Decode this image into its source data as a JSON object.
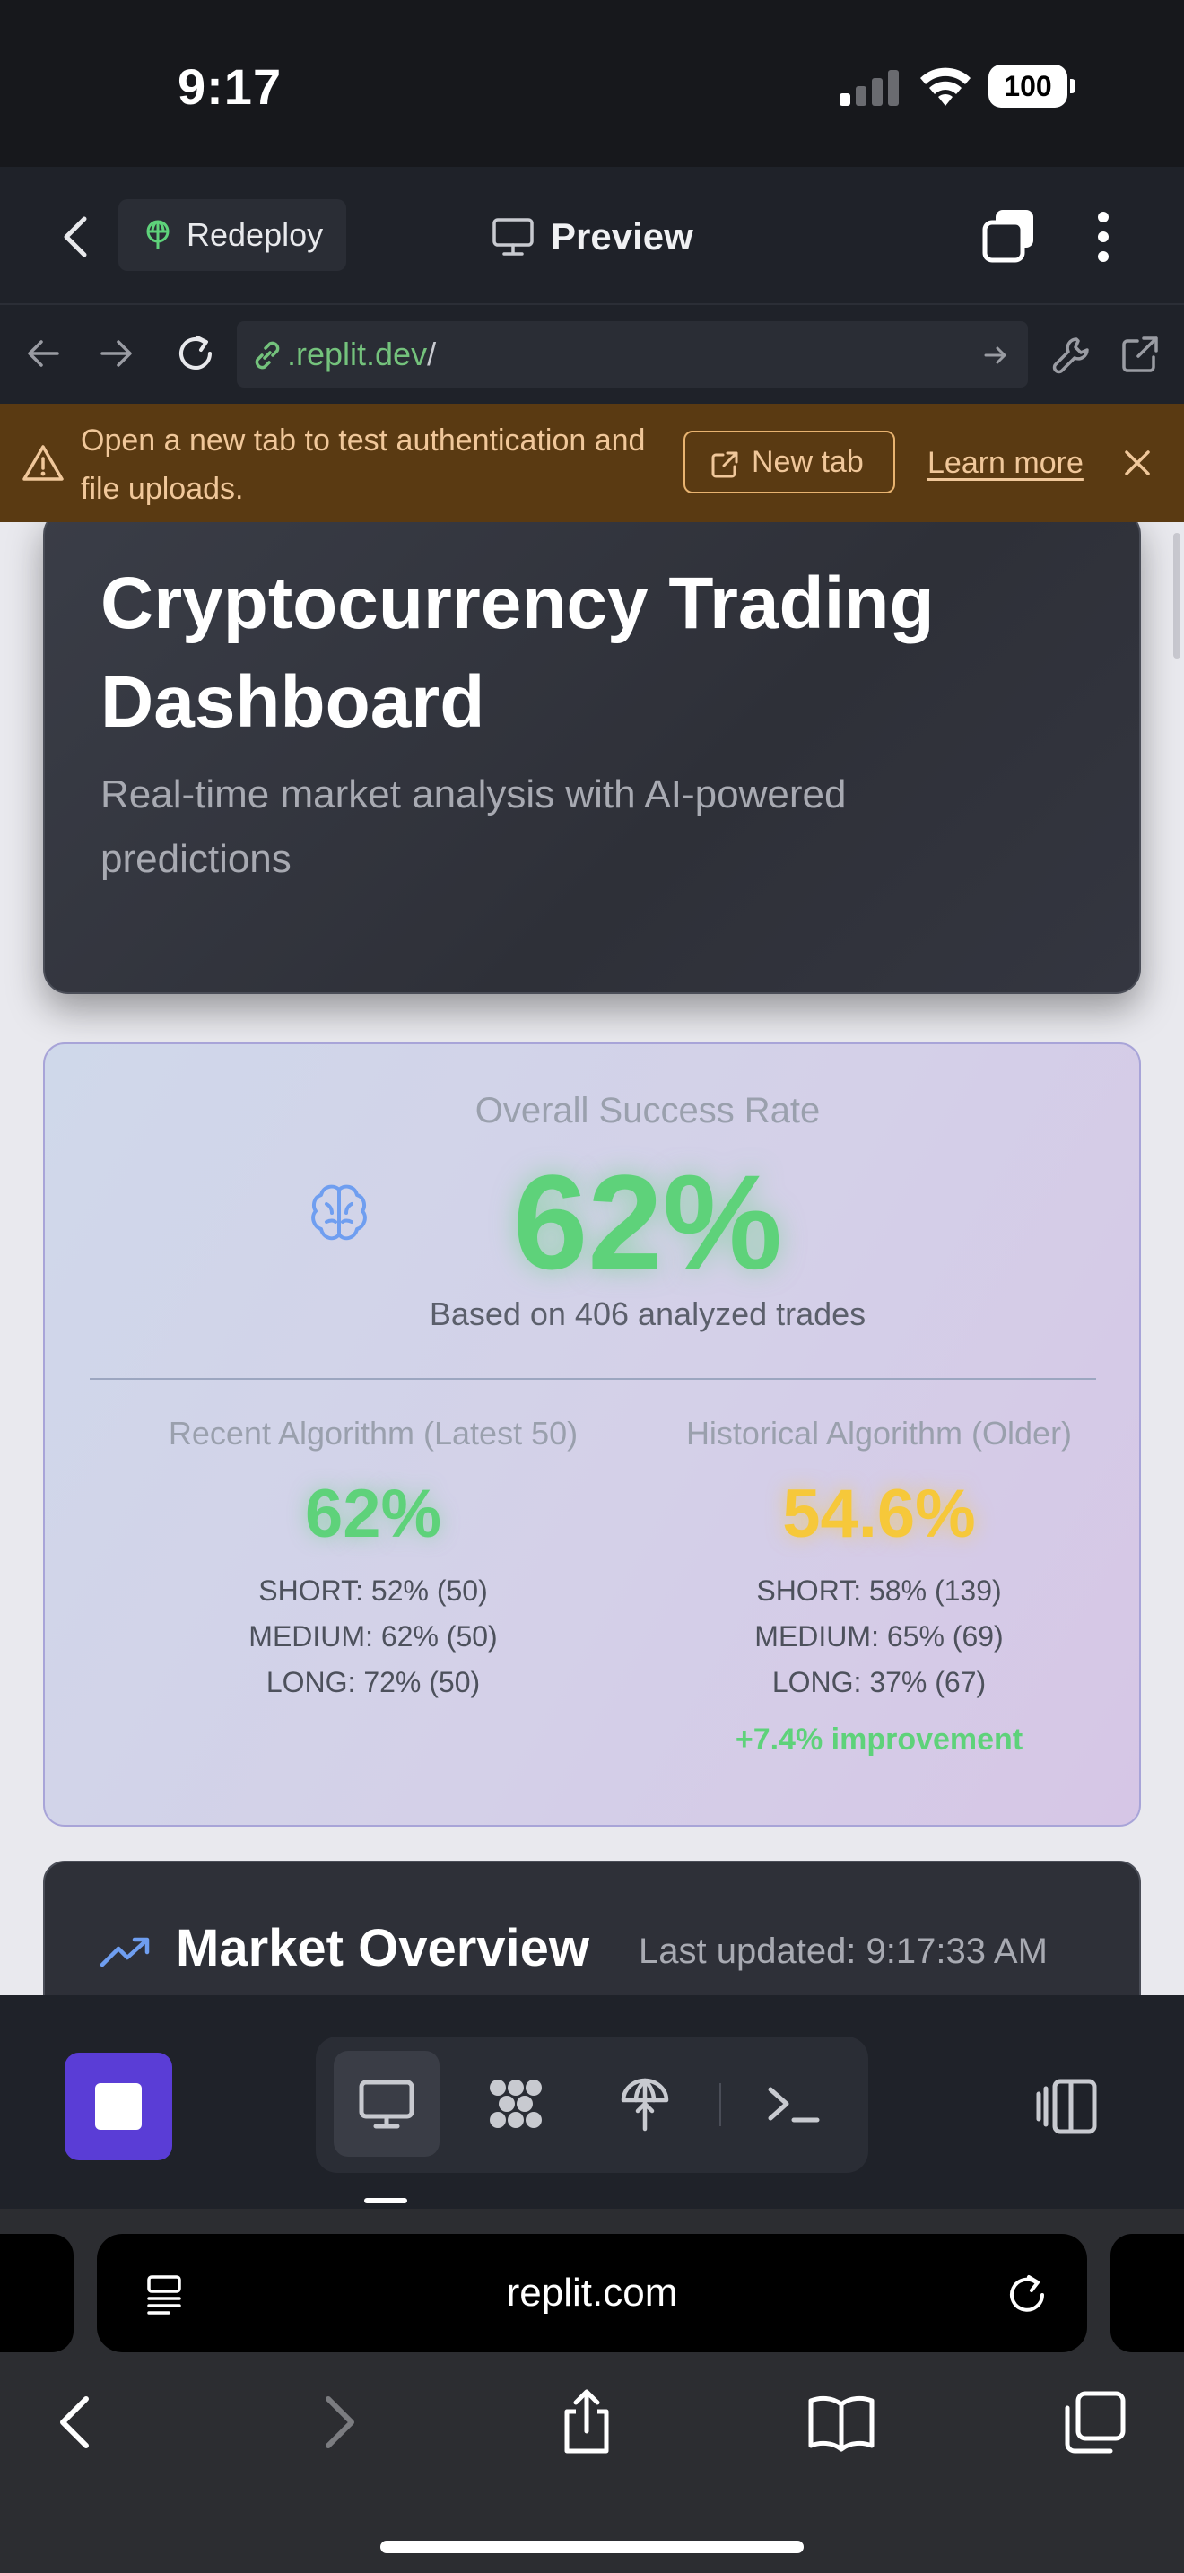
{
  "status_bar": {
    "time": "9:17",
    "battery": "100"
  },
  "replit_header": {
    "redeploy_label": "Redeploy",
    "preview_label": "Preview"
  },
  "url_bar": {
    "domain": ".replit.dev",
    "path": "/"
  },
  "banner": {
    "message": "Open a new tab to test authentication and file uploads.",
    "new_tab_label": "New tab",
    "learn_more_label": "Learn more"
  },
  "hero": {
    "title": "Cryptocurrency Trading Dashboard",
    "subtitle": "Real-time market analysis with AI-powered predictions"
  },
  "success": {
    "label": "Overall Success Rate",
    "value": "62%",
    "basis": "Based on 406 analyzed trades",
    "recent": {
      "title": "Recent Algorithm (Latest 50)",
      "value": "62%",
      "short": "SHORT: 52% (50)",
      "medium": "MEDIUM: 62% (50)",
      "long": "LONG: 72% (50)"
    },
    "historical": {
      "title": "Historical Algorithm (Older)",
      "value": "54.6%",
      "short": "SHORT: 58% (139)",
      "medium": "MEDIUM: 65% (69)",
      "long": "LONG: 37% (67)",
      "improvement": "+7.4% improvement"
    },
    "colors": {
      "positive": "#5ed27a",
      "historical": "#f6c83a"
    }
  },
  "market": {
    "title": "Market Overview",
    "last_updated": "Last updated: 9:17:33 AM"
  },
  "safari": {
    "address": "replit.com"
  },
  "icons": [
    "back-chevron-icon",
    "redeploy-icon",
    "monitor-icon",
    "tabs-icon",
    "more-vertical-icon",
    "arrow-left-icon",
    "arrow-right-icon",
    "reload-icon",
    "link-icon",
    "wrench-icon",
    "external-link-icon",
    "warning-icon",
    "close-icon",
    "brain-icon",
    "trending-up-icon",
    "stop-icon",
    "apps-icon",
    "deploy-icon",
    "terminal-icon",
    "split-view-icon",
    "share-icon",
    "bookmarks-icon"
  ],
  "theme": {
    "accent_purple": "#5a3dd6",
    "banner_bg": "#5a3a12",
    "link_green": "#74c27c"
  }
}
